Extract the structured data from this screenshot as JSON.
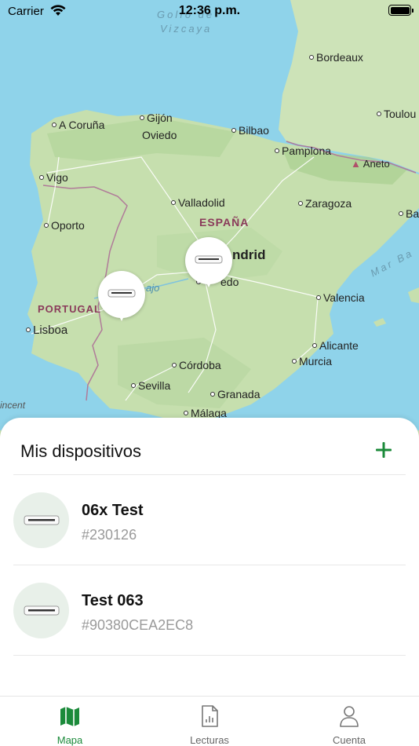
{
  "status_bar": {
    "carrier": "Carrier",
    "time": "12:36 p.m."
  },
  "map": {
    "labels": {
      "golfo": "Golfo de",
      "vizcaya": "Vizcaya",
      "bordeaux": "Bordeaux",
      "toulouse": "Toulou",
      "acoruna": "A Coruña",
      "gijon": "Gijón",
      "oviedo": "Oviedo",
      "bilbao": "Bilbao",
      "pamplona": "Pamplona",
      "aneto": "Aneto",
      "vigo": "Vigo",
      "valladolid": "Valladolid",
      "espana": "ESPAÑA",
      "zaragoza": "Zaragoza",
      "ba": "Ba",
      "oporto": "Oporto",
      "madrid": "ndrid",
      "toledo": "edo",
      "tajo": "ajo",
      "mar": "Mar Ba",
      "portugal": "PORTUGAL",
      "lisboa": "Lisboa",
      "valencia": "Valencia",
      "alicante": "Alicante",
      "murcia": "Murcia",
      "cordoba": "Córdoba",
      "sevilla": "Sevilla",
      "granada": "Granada",
      "malaga": "Málaga",
      "vincent": "incent"
    }
  },
  "sheet": {
    "title": "Mis dispositivos",
    "devices": [
      {
        "name": "06x Test",
        "serial": "#230126"
      },
      {
        "name": "Test 063",
        "serial": "#90380CEA2EC8"
      }
    ]
  },
  "tabs": [
    {
      "label": "Mapa",
      "icon": "map-icon",
      "active": true
    },
    {
      "label": "Lecturas",
      "icon": "report-icon",
      "active": false
    },
    {
      "label": "Cuenta",
      "icon": "person-icon",
      "active": false
    }
  ],
  "colors": {
    "accent": "#1b8a3a",
    "water": "#8fd3ea",
    "land": "#c9e1b4",
    "device_bg": "#e8f0e9"
  }
}
